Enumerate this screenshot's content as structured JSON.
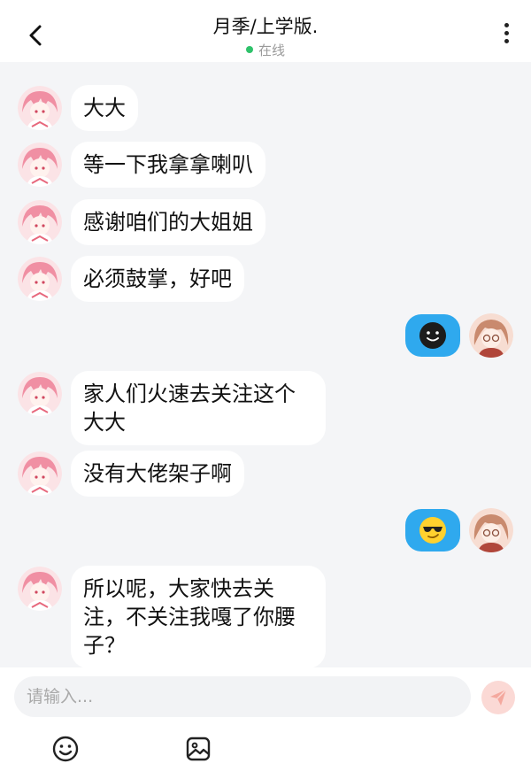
{
  "header": {
    "title": "月季/上学版.",
    "status": "在线"
  },
  "chat": {
    "partial_top_bubble": "…",
    "messages": [
      {
        "side": "left",
        "text": "大大"
      },
      {
        "side": "left",
        "text": "等一下我拿拿喇叭"
      },
      {
        "side": "left",
        "text": "感谢咱们的大姐姐"
      },
      {
        "side": "left",
        "text": "必须鼓掌，好吧"
      },
      {
        "side": "right",
        "emoji": "black-smile-emoji"
      },
      {
        "side": "left",
        "text": "家人们火速去关注这个大大"
      },
      {
        "side": "left",
        "text": "没有大佬架子啊"
      },
      {
        "side": "right",
        "emoji": "sunglasses-emoji"
      },
      {
        "side": "left",
        "text": "所以呢，大家快去关注，不关注我嘎了你腰子？"
      }
    ]
  },
  "input": {
    "placeholder": "请输入..."
  },
  "colors": {
    "accent_bubble": "#2fa9ee",
    "online_dot": "#2fc26b",
    "send_button_bg": "#fbd9d5"
  },
  "icons": {
    "back": "chevron-left-icon",
    "more": "vertical-dots-icon",
    "send": "paper-plane-icon",
    "emoji": "smiley-icon",
    "image": "image-icon"
  }
}
